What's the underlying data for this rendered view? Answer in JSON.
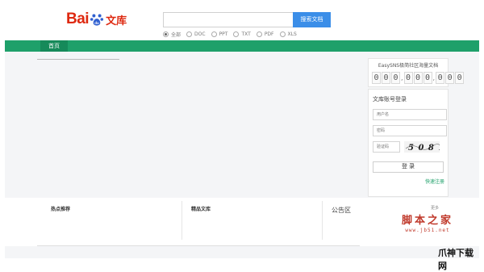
{
  "header": {
    "logo": {
      "text_bai": "Bai",
      "text_du": "du",
      "text_wenku": "文库",
      "brand_color": "#de2910"
    },
    "search": {
      "placeholder": "",
      "button_label": "搜索文档",
      "button_color": "#3b8ee8"
    },
    "filters": [
      {
        "label": "全部",
        "selected": true
      },
      {
        "label": "DOC",
        "selected": false
      },
      {
        "label": "PPT",
        "selected": false
      },
      {
        "label": "TXT",
        "selected": false
      },
      {
        "label": "PDF",
        "selected": false
      },
      {
        "label": "XLS",
        "selected": false
      }
    ]
  },
  "nav": {
    "items": [
      {
        "label": "首页",
        "active": true
      }
    ],
    "color": "#1ea06a"
  },
  "counter": {
    "title": "EasySNS极简社区海量文档",
    "digits": [
      "0",
      "0",
      "0",
      "0",
      "0",
      "0",
      "0",
      "0",
      "0"
    ]
  },
  "login": {
    "title": "文库账号登录",
    "username_placeholder": "用户名",
    "password_placeholder": "密码",
    "captcha_placeholder": "验证码",
    "captcha_text": "5 0 8 1",
    "login_label": "登 录",
    "register_label": "快速注册"
  },
  "bottom": {
    "hot_title": "热点推荐",
    "featured_title": "精品文库",
    "notice_title": "公告区",
    "notice_more": "更多"
  },
  "watermarks": {
    "jb51_cn": "脚本之家",
    "jb51_url": "www.jb51.net",
    "fengshen": "爪神下载网"
  }
}
